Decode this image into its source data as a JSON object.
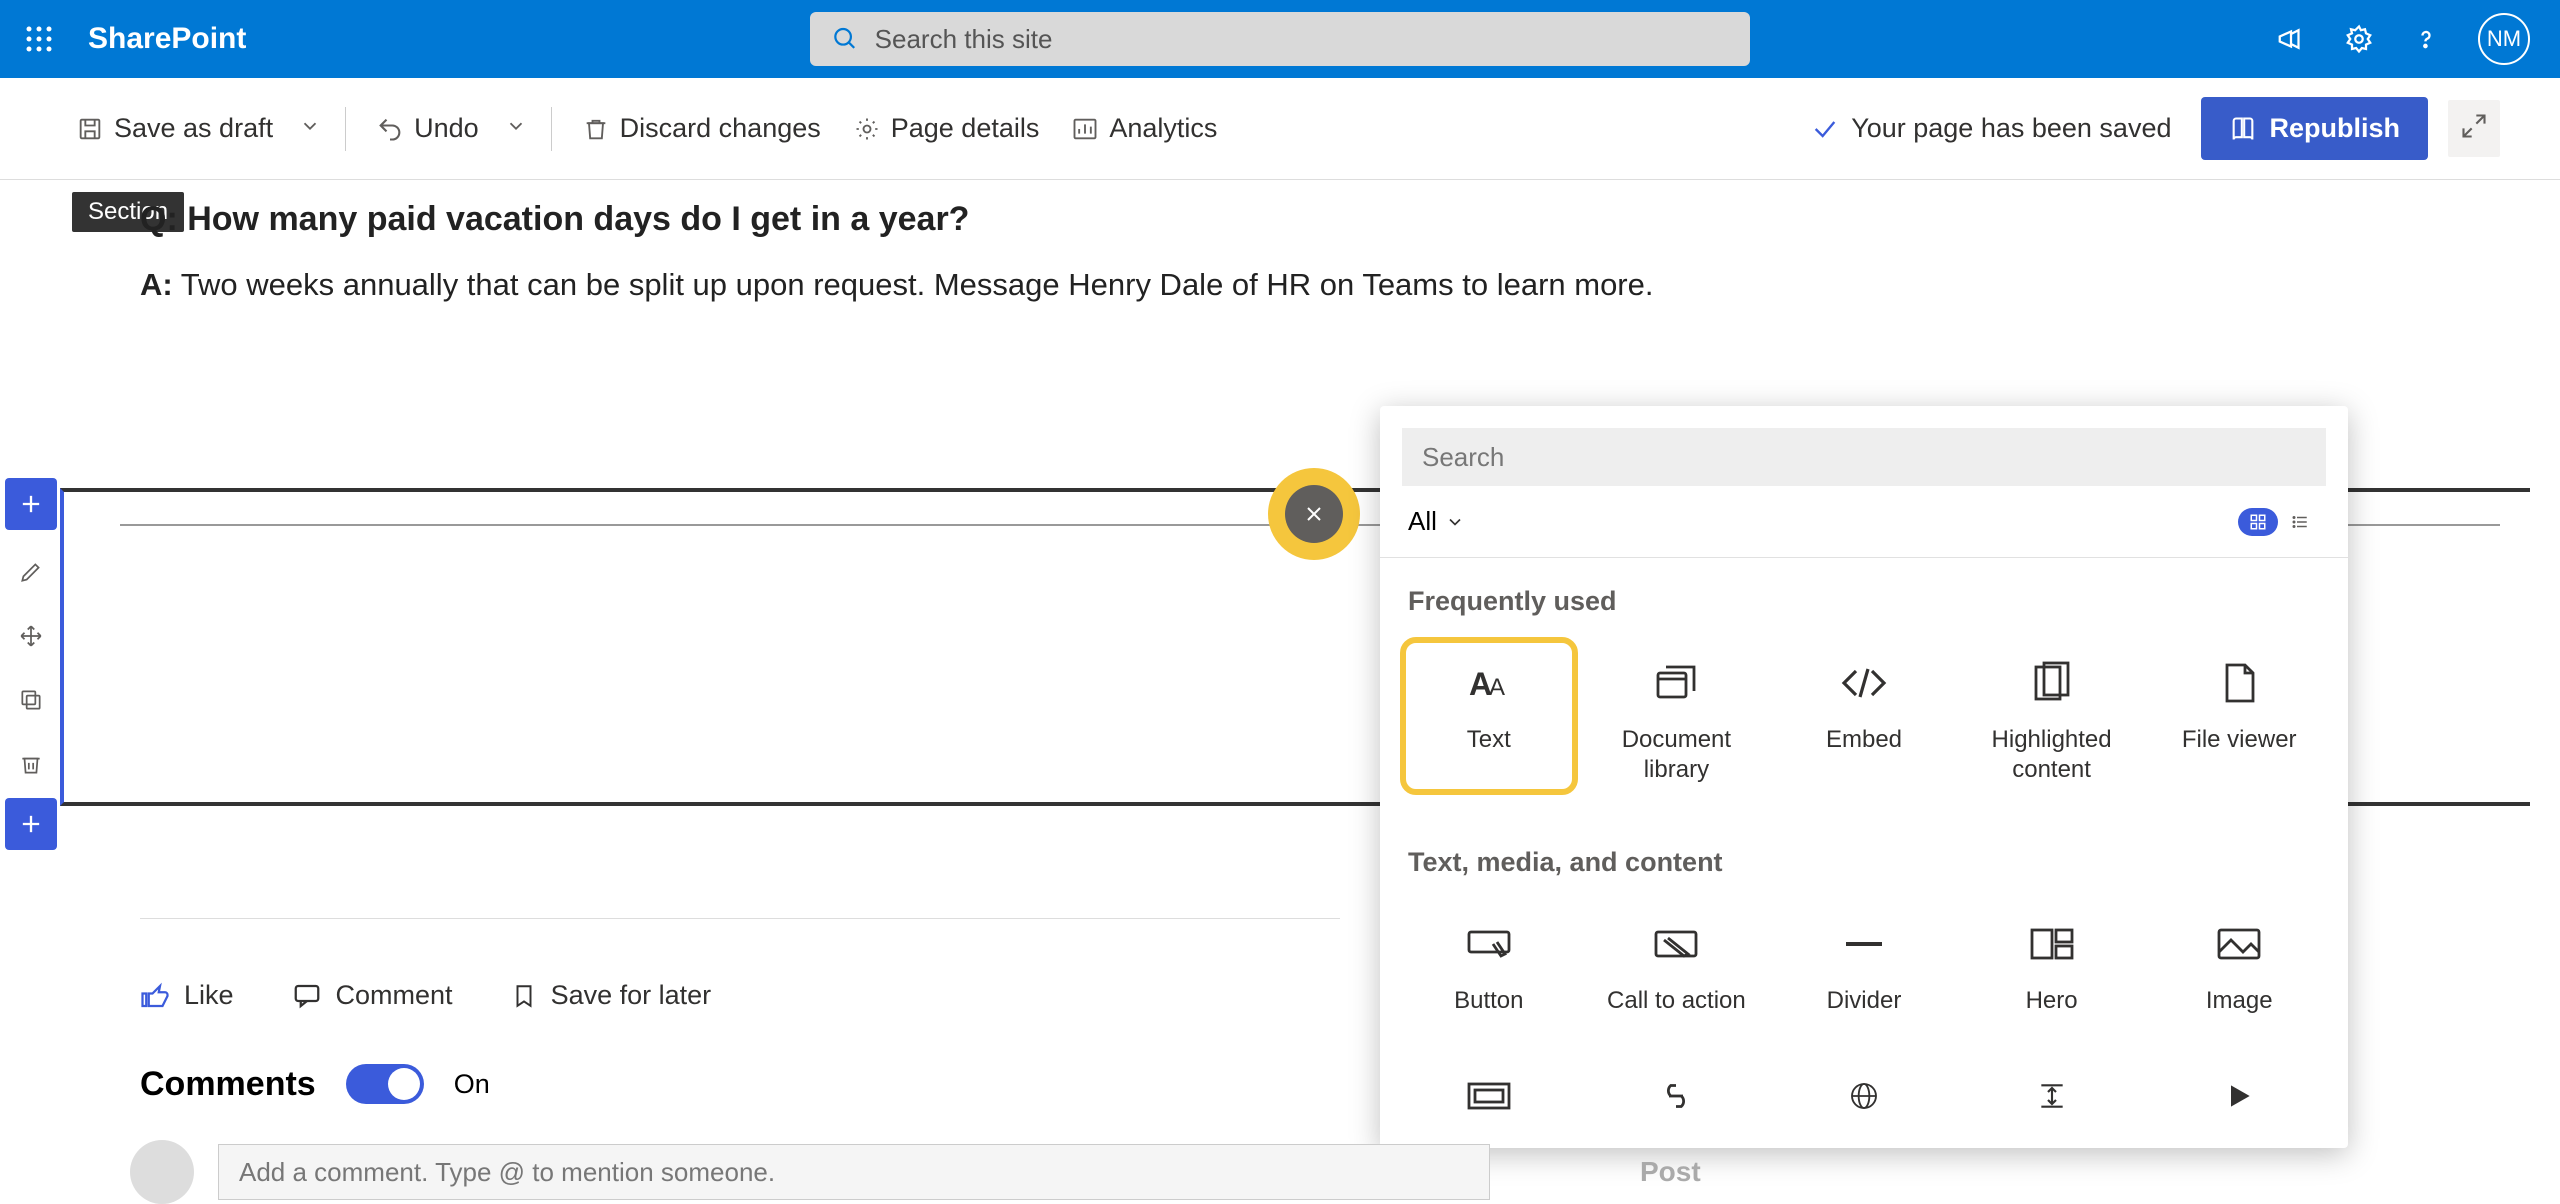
{
  "header": {
    "app_name": "SharePoint",
    "search_placeholder": "Search this site",
    "avatar_initials": "NM"
  },
  "commandbar": {
    "save_draft": "Save as draft",
    "undo": "Undo",
    "discard": "Discard changes",
    "page_details": "Page details",
    "analytics": "Analytics",
    "saved_status": "Your page has been saved",
    "republish": "Republish"
  },
  "section_tag": "Section",
  "qa": {
    "q_prefix": "Q:",
    "q_text": " How many paid vacation days do I get in a year?",
    "a_prefix": "A:",
    "a_text": " Two weeks annually that can be split up upon request. Message Henry Dale of HR on Teams to learn more."
  },
  "picker": {
    "search_placeholder": "Search",
    "filter_label": "All",
    "sections": {
      "frequent": {
        "title": "Frequently used",
        "items": [
          "Text",
          "Document library",
          "Embed",
          "Highlighted content",
          "File viewer"
        ]
      },
      "tmc": {
        "title": "Text, media, and content",
        "items": [
          "Button",
          "Call to action",
          "Divider",
          "Hero",
          "Image"
        ]
      }
    }
  },
  "social": {
    "like": "Like",
    "comment": "Comment",
    "save": "Save for later"
  },
  "comments": {
    "heading": "Comments",
    "toggle_state": "On",
    "placeholder": "Add a comment. Type @ to mention someone.",
    "post_label": "Post"
  }
}
